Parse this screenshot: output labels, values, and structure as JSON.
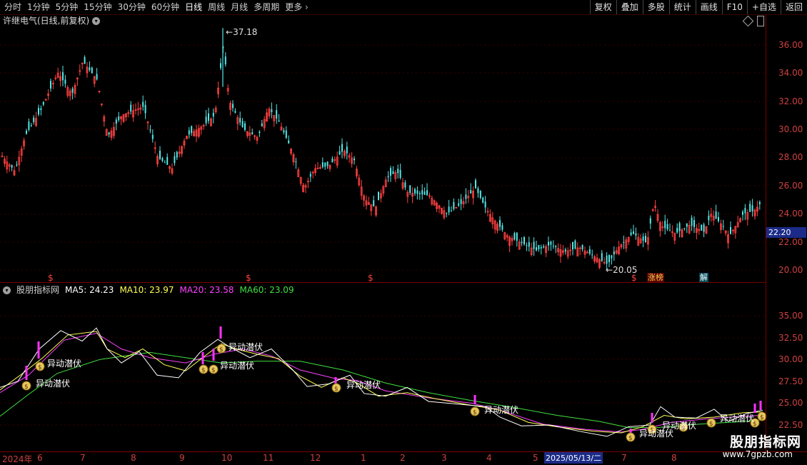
{
  "toolbar": {
    "periods": [
      "分时",
      "1分钟",
      "5分钟",
      "15分钟",
      "30分钟",
      "60分钟",
      "日线",
      "周线",
      "月线",
      "多周期",
      "更多"
    ],
    "tools": [
      "复权",
      "叠加",
      "多股",
      "统计",
      "画线",
      "F10",
      "+自选",
      "返回"
    ]
  },
  "main_title": "许继电气(日线,前复权)",
  "high_label": "37.18",
  "low_label": "20.05",
  "current_price": "22.20",
  "price_ticks": [
    "36.00",
    "34.00",
    "32.00",
    "30.00",
    "28.00",
    "26.00",
    "24.00",
    "22.00",
    "20.00"
  ],
  "indicator": {
    "name": "股朋指标网",
    "ma5": "MA5: 24.23",
    "ma10": "MA10: 23.97",
    "ma20": "MA20: 23.58",
    "ma60": "MA60: 23.09",
    "ticks": [
      "35.00",
      "32.50",
      "30.00",
      "27.50",
      "25.00",
      "22.50"
    ],
    "signal_label": "异动潜伏"
  },
  "event_tags": {
    "zhangting": "涨榜",
    "jie": "解"
  },
  "dates": [
    "2024年",
    "6",
    "7",
    "8",
    "9",
    "10",
    "11",
    "12",
    "1",
    "2",
    "3",
    "4",
    "5",
    "2025/05/13/二",
    "7",
    "8"
  ],
  "watermark": {
    "title": "股朋指标网",
    "url": "www.7gpzb.com"
  },
  "colors": {
    "up": "#ff4040",
    "down": "#54e8e8",
    "ma5": "#ffffff",
    "ma10": "#ffff55",
    "ma20": "#ff40ff",
    "ma60": "#40e040"
  }
}
